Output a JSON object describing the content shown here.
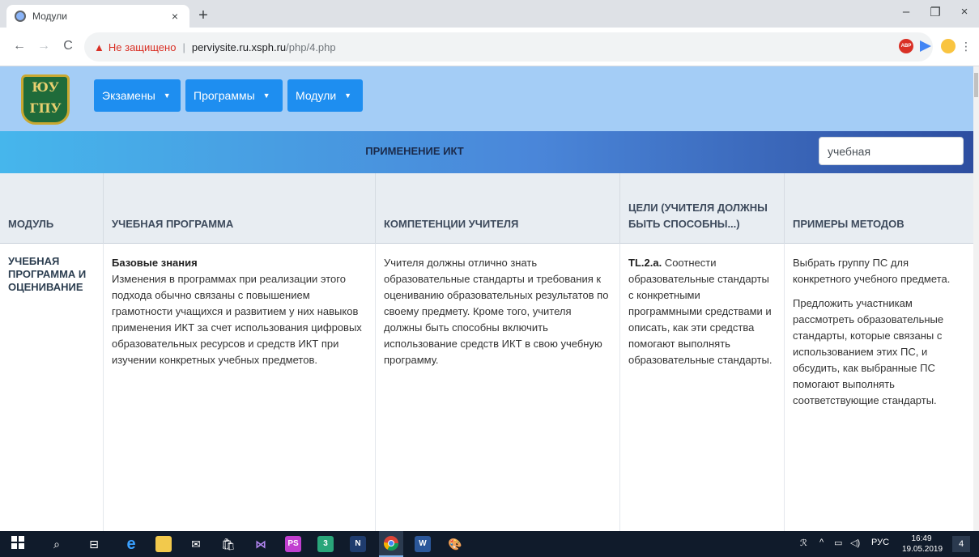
{
  "browser": {
    "tab_title": "Модули",
    "tab_close": "×",
    "new_tab": "+",
    "window_controls": {
      "minimize": "–",
      "restore": "❐",
      "close": "×"
    },
    "nav": {
      "back": "←",
      "forward": "→",
      "reload": "C"
    },
    "security_label": "Не защищено",
    "url_separator": "|",
    "url_host": "perviysite.ru.xsph.ru",
    "url_path": "/php/4.php",
    "extensions": [
      "star-icon",
      "adblock-icon",
      "send-icon",
      "profile-emoji-icon",
      "menu-dots-icon"
    ],
    "ext_abp": "ABP",
    "menu_dots": "⋮"
  },
  "site": {
    "logo_text": "ЮУ ГПУ",
    "menu": [
      {
        "label": "Экзамены"
      },
      {
        "label": "Программы"
      },
      {
        "label": "Модули"
      }
    ],
    "page_title": "ПРИМЕНЕНИЕ ИКТ",
    "search_value": "учебная",
    "accent_color": "#1e8ef0"
  },
  "table": {
    "headers": [
      "МОДУЛЬ",
      "УЧЕБНАЯ ПРОГРАММА",
      "КОМПЕТЕНЦИИ УЧИТЕЛЯ",
      "ЦЕЛИ (УЧИТЕЛЯ ДОЛЖНЫ БЫТЬ СПОСОБНЫ...)",
      "ПРИМЕРЫ МЕТОДОВ"
    ],
    "row": {
      "module": "УЧЕБНАЯ ПРОГРАММА И ОЦЕНИВАНИЕ",
      "program_heading": "Базовые знания",
      "program_text": "Изменения в программах при реализации этого подхода обычно связаны с повышением грамотности учащихся и развитием у них навыков применения ИКТ за счет использования цифровых образовательных ресурсов и средств ИКТ при изучении конкретных учебных предметов.",
      "competence_text": "Учителя должны отлично знать образовательные стандарты и требования к оцениванию образовательных результатов по своему предмету. Кроме того, учителя должны быть способны включить использование средств ИКТ в свою учебную программу.",
      "goal_code": "TL.2.a.",
      "goal_text": "Соотнести образовательные стандарты с конкретными программными средствами и описать, как эти средства помогают выполнять образовательные стандарты.",
      "methods_p1": "Выбрать группу ПС для конкретного учебного предмета.",
      "methods_p2": "Предложить участникам рассмотреть образовательные стандарты, которые связаны с использованием этих ПС, и обсудить, как выбранные ПС помогают выполнять соответствующие стандарты."
    }
  },
  "taskbar": {
    "icons": [
      "windows-start-icon",
      "search-icon",
      "task-view-icon",
      "edge-icon",
      "file-explorer-icon",
      "mail-icon",
      "store-icon",
      "visual-studio-icon",
      "phpstorm-icon",
      "app-3-icon",
      "app-n-icon",
      "chrome-icon",
      "word-icon",
      "paint-icon"
    ],
    "phpstorm_label": "PS",
    "app3_label": "3",
    "word_label": "W",
    "tray_lang": "РУС",
    "time": "16:49",
    "date": "19.05.2019",
    "notification_count": "4"
  }
}
